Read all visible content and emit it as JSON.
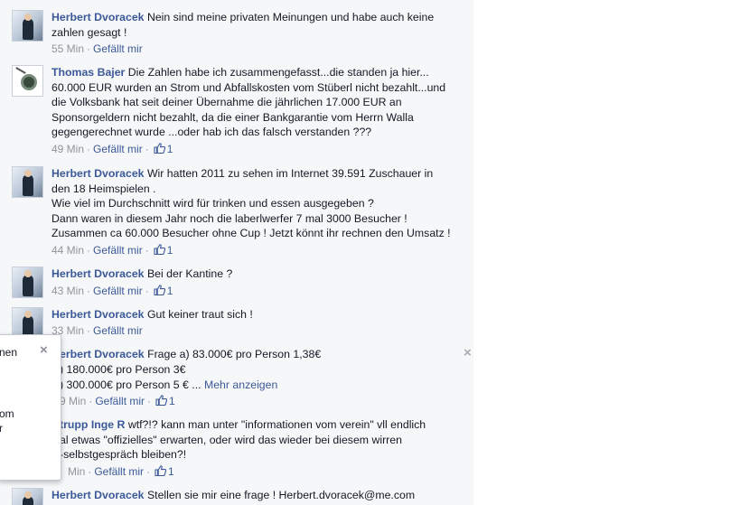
{
  "comments": [
    {
      "author": "Herbert Dvoracek",
      "text_lines": [
        "Nein sind meine privaten Meinungen und habe auch keine",
        "zahlen gesagt !"
      ],
      "time": "55 Min",
      "like_label": "Gefällt mir",
      "likes": ""
    },
    {
      "author": "Thomas Bajer",
      "text_lines": [
        "Die Zahlen habe ich zusammengefasst...die standen ja hier...",
        "60.000 EUR wurden an Strom und Abfallskosten vom Stüberl nicht bezahlt...und",
        "die Volksbank hat seit deiner Übernahme die jährlichen 17.000 EUR an",
        "Sponsorgeldern nicht bezahlt, da die einer Bankgarantie vom Herrn Walla",
        "gegengerechnet wurde ...oder hab ich das falsch verstanden ???"
      ],
      "time": "49 Min",
      "like_label": "Gefällt mir",
      "likes": "1"
    },
    {
      "author": "Herbert Dvoracek",
      "text_lines": [
        "Wir hatten 2011 zu sehen im Internet 39.591 Zuschauer in",
        "den 18 Heimspielen .",
        "Wie viel im Durchschnitt wird für trinken und essen ausgegeben ?",
        "Dann waren in diesem Jahr noch die laberlwerfer 7 mal 3000 Besucher !",
        "Zusammen ca 60.000 Besucher ohne Cup ! Jetzt könnt ihr rechnen den Umsatz !"
      ],
      "time": "44 Min",
      "like_label": "Gefällt mir",
      "likes": "1"
    },
    {
      "author": "Herbert Dvoracek",
      "text_lines": [
        "Bei der Kantine ?"
      ],
      "time": "43 Min",
      "like_label": "Gefällt mir",
      "likes": "1"
    },
    {
      "author": "Herbert Dvoracek",
      "text_lines": [
        "Gut keiner traut sich !"
      ],
      "time": "33 Min",
      "like_label": "Gefällt mir",
      "likes": ""
    },
    {
      "author": "erbert Dvoracek",
      "text_lines": [
        "Frage a) 83.000€ pro Person 1,38€",
        ") 180.000€ pro Person 3€",
        ") 300.000€ pro Person 5 € ..."
      ],
      "more_label": "Mehr anzeigen",
      "time": "9 Min",
      "like_label": "Gefällt mir",
      "likes": "1"
    },
    {
      "author": "trupp Inge R",
      "text_lines": [
        "wtf?!? kann man unter \"informationen vom verein\" vll endlich",
        "al etwas \"offizielles\" erwarten, oder wird das wieder bei diesem wirren",
        "-selbstgespräch bleiben?!"
      ],
      "time": "Min",
      "like_label": "Gefällt mir",
      "likes": "1"
    },
    {
      "author": "Herbert Dvoracek",
      "text_lines": [
        "Stellen sie mir eine frage ! Herbert.dvoracek@me.com"
      ],
      "time": "",
      "like_label": "",
      "likes": ""
    }
  ],
  "popup": {
    "lines": [
      "nen",
      "om",
      "r"
    ],
    "close": "×"
  },
  "comment_close": "×",
  "colors": {
    "link": "#3b5998",
    "meta": "#90949c",
    "feed_bg": "#f6f7f9"
  },
  "icons": {
    "like": "thumbs-up-icon",
    "close": "close-icon"
  }
}
